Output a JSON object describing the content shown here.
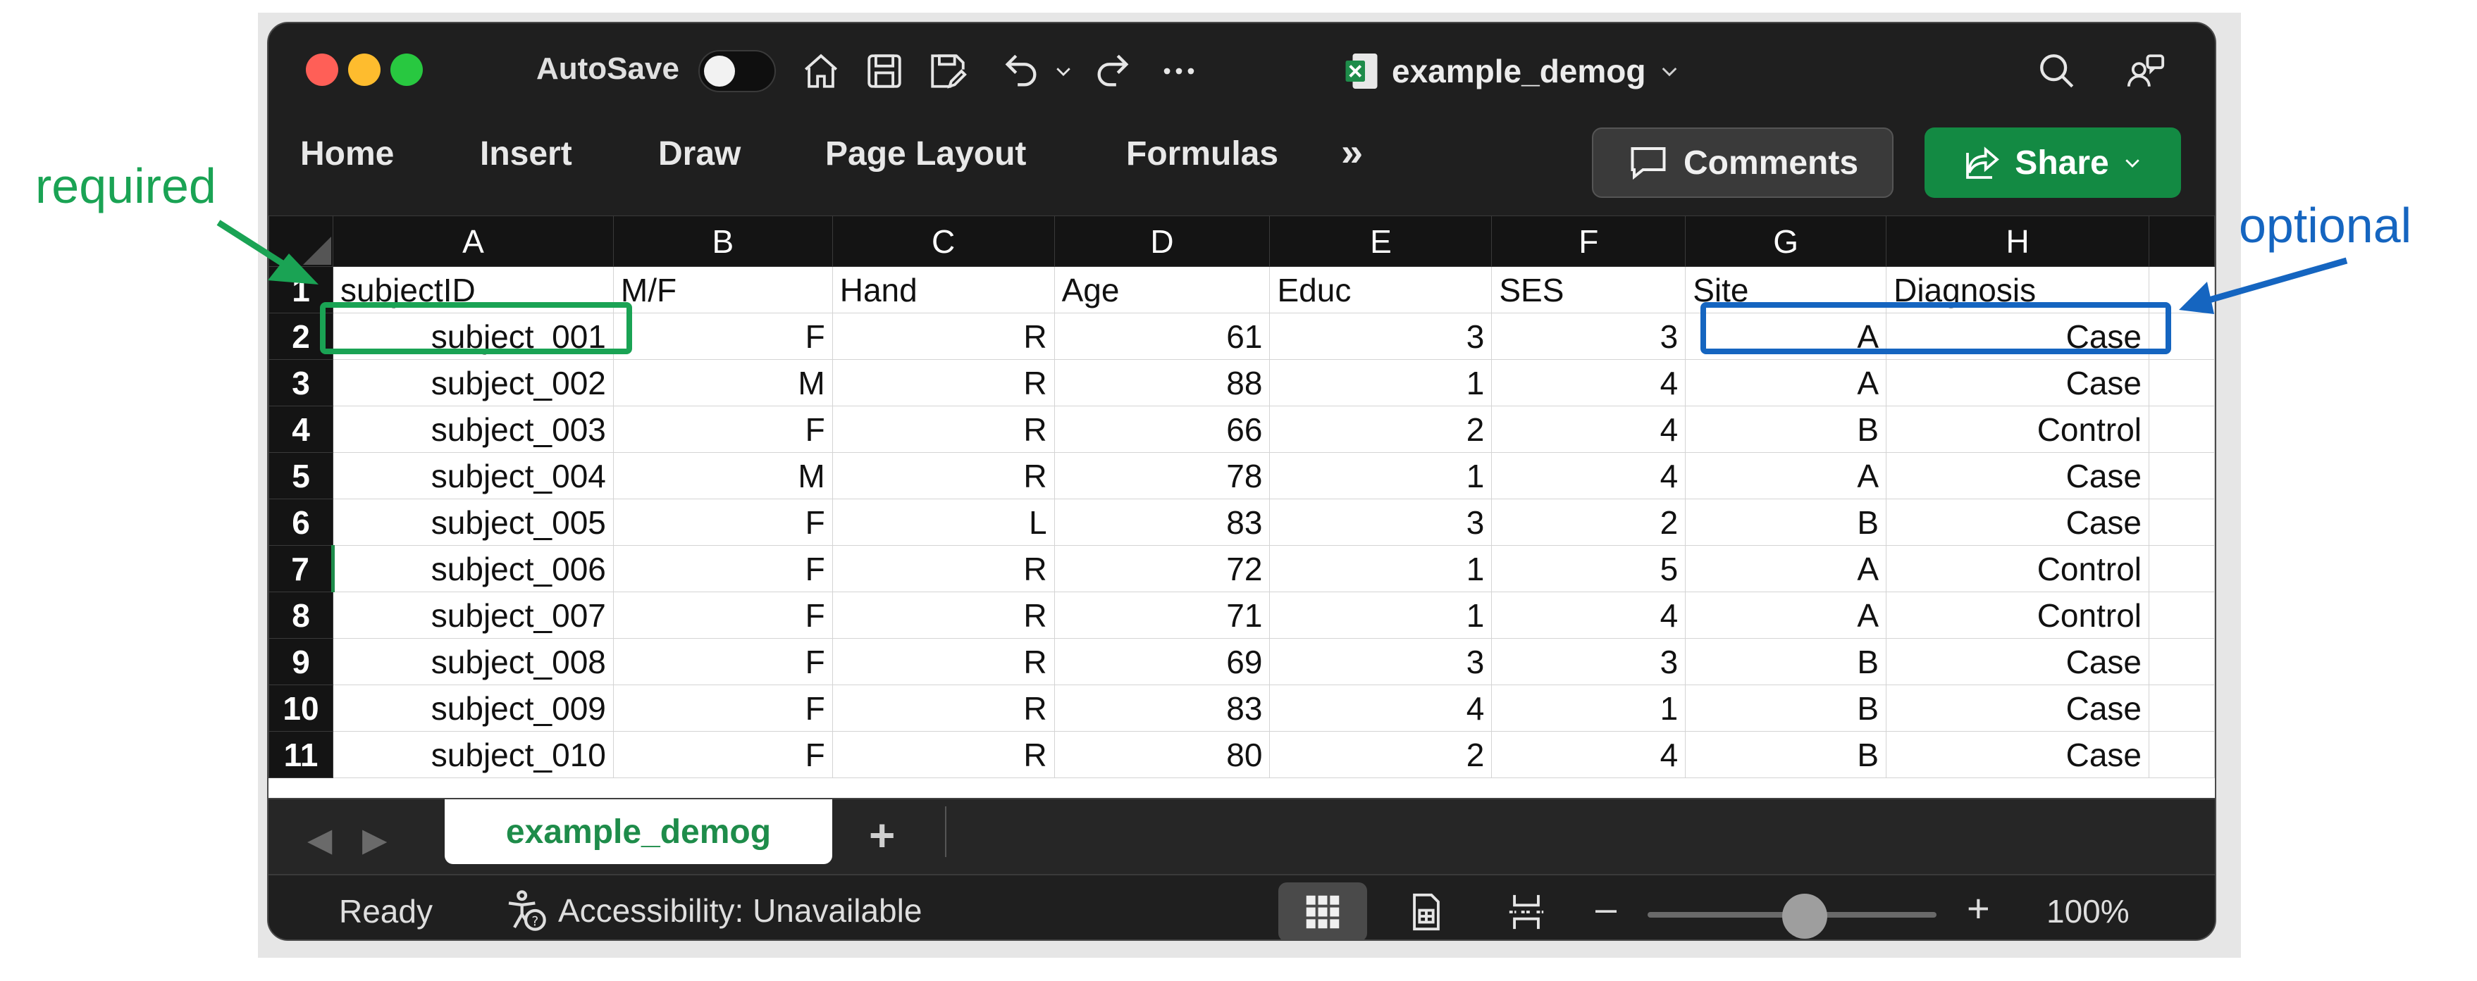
{
  "titlebar": {
    "autosave_label": "AutoSave",
    "autosave_on": false,
    "document_name": "example_demog"
  },
  "ribbon": {
    "tabs": [
      "Home",
      "Insert",
      "Draw",
      "Page Layout",
      "Formulas"
    ],
    "more_glyph": "»",
    "comments_label": "Comments",
    "share_label": "Share"
  },
  "sheet": {
    "columns": [
      "A",
      "B",
      "C",
      "D",
      "E",
      "F",
      "G",
      "H"
    ],
    "headers": [
      "subjectID",
      "M/F",
      "Hand",
      "Age",
      "Educ",
      "SES",
      "Site",
      "Diagnosis"
    ],
    "rows": [
      {
        "n": "2",
        "cells": [
          "subject_001",
          "F",
          "R",
          "61",
          "3",
          "3",
          "A",
          "Case"
        ]
      },
      {
        "n": "3",
        "cells": [
          "subject_002",
          "M",
          "R",
          "88",
          "1",
          "4",
          "A",
          "Case"
        ]
      },
      {
        "n": "4",
        "cells": [
          "subject_003",
          "F",
          "R",
          "66",
          "2",
          "4",
          "B",
          "Control"
        ]
      },
      {
        "n": "5",
        "cells": [
          "subject_004",
          "M",
          "R",
          "78",
          "1",
          "4",
          "A",
          "Case"
        ]
      },
      {
        "n": "6",
        "cells": [
          "subject_005",
          "F",
          "L",
          "83",
          "3",
          "2",
          "B",
          "Case"
        ]
      },
      {
        "n": "7",
        "cells": [
          "subject_006",
          "F",
          "R",
          "72",
          "1",
          "5",
          "A",
          "Control"
        ]
      },
      {
        "n": "8",
        "cells": [
          "subject_007",
          "F",
          "R",
          "71",
          "1",
          "4",
          "A",
          "Control"
        ]
      },
      {
        "n": "9",
        "cells": [
          "subject_008",
          "F",
          "R",
          "69",
          "3",
          "3",
          "B",
          "Case"
        ]
      },
      {
        "n": "10",
        "cells": [
          "subject_009",
          "F",
          "R",
          "83",
          "4",
          "1",
          "B",
          "Case"
        ]
      },
      {
        "n": "11",
        "cells": [
          "subject_010",
          "F",
          "R",
          "80",
          "2",
          "4",
          "B",
          "Case"
        ]
      }
    ],
    "active_row": "7"
  },
  "sheet_tabs": {
    "active": "example_demog",
    "add_glyph": "+"
  },
  "status": {
    "ready": "Ready",
    "accessibility": "Accessibility: Unavailable",
    "zoom_minus": "–",
    "zoom_plus": "+",
    "zoom_level": "100%",
    "zoom_fraction": 0.5
  },
  "annotations": {
    "required": "required",
    "optional": "optional"
  },
  "colors": {
    "required": "#1aa354",
    "optional": "#1565c0",
    "share": "#138a43",
    "accent_green": "#1e8c4a"
  }
}
